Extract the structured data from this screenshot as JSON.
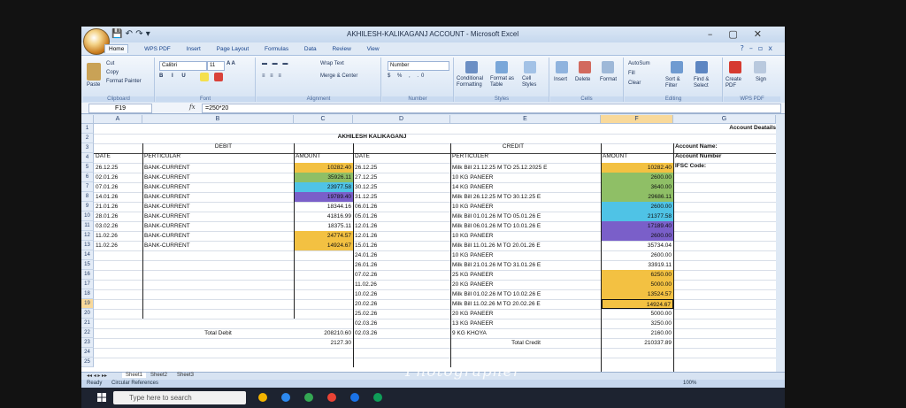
{
  "window": {
    "title": "AKHILESH-KALIKAGANJ ACCOUNT - Microsoft Excel",
    "minimize": "–",
    "maximize": "▢",
    "close": "✕"
  },
  "ribbon_tabs": [
    "Home",
    "WPS PDF",
    "Insert",
    "Page Layout",
    "Formulas",
    "Data",
    "Review",
    "View"
  ],
  "ribbon": {
    "clipboard": {
      "label": "Clipboard",
      "paste": "Paste",
      "cut": "Cut",
      "copy": "Copy",
      "format_painter": "Format Painter"
    },
    "font": {
      "label": "Font",
      "name": "Calibri",
      "size": "11"
    },
    "alignment": {
      "label": "Alignment",
      "wrap_text": "Wrap Text",
      "merge_center": "Merge & Center"
    },
    "number": {
      "label": "Number",
      "format": "Number"
    },
    "styles": {
      "label": "Styles",
      "conditional": "Conditional Formatting",
      "format_table": "Format as Table",
      "cell_styles": "Cell Styles"
    },
    "cells": {
      "label": "Cells",
      "insert": "Insert",
      "delete": "Delete",
      "format": "Format"
    },
    "editing": {
      "label": "Editing",
      "autosum": "AutoSum",
      "fill": "Fill",
      "clear": "Clear",
      "sort": "Sort & Filter",
      "find": "Find & Select"
    },
    "wps": {
      "label": "WPS PDF",
      "create": "Create PDF",
      "sign": "Sign"
    }
  },
  "formula_bar": {
    "name_box": "F19",
    "fx": "fx",
    "formula": "=250*20"
  },
  "columns": [
    "A",
    "B",
    "C",
    "D",
    "E",
    "F",
    "G"
  ],
  "rows": [
    "1",
    "2",
    "3",
    "4",
    "5",
    "6",
    "7",
    "8",
    "9",
    "10",
    "11",
    "12",
    "13",
    "14",
    "15",
    "16",
    "17",
    "18",
    "19",
    "20",
    "21",
    "22",
    "23",
    "24",
    "25"
  ],
  "sheet": {
    "title": "AKHILESH KALIKAGANJ",
    "debit_label": "DEBIT",
    "credit_label": "CREDIT",
    "headers": {
      "date": "DATE",
      "perticular": "PERTICULAR",
      "amount": "AMOUNT",
      "date2": "DATE",
      "perticuler": "PERTICULER",
      "amount2": "AMOUNT"
    },
    "debit_rows": [
      {
        "date": "26.12.25",
        "perticular": "BANK-CURRENT",
        "amount": "10282.40"
      },
      {
        "date": "02.01.26",
        "perticular": "BANK-CURRENT",
        "amount": "35926.11"
      },
      {
        "date": "07.01.26",
        "perticular": "BANK-CURRENT",
        "amount": "23977.58"
      },
      {
        "date": "14.01.26",
        "perticular": "BANK-CURRENT",
        "amount": "19789.40"
      },
      {
        "date": "21.01.26",
        "perticular": "BANK-CURRENT",
        "amount": "18344.16"
      },
      {
        "date": "28.01.26",
        "perticular": "BANK-CURRENT",
        "amount": "41816.99"
      },
      {
        "date": "03.02.26",
        "perticular": "BANK-CURRENT",
        "amount": "18375.11"
      },
      {
        "date": "11.02.26",
        "perticular": "BANK-CURRENT",
        "amount": "24774.57"
      },
      {
        "date": "11.02.26",
        "perticular": "BANK-CURRENT",
        "amount": "14924.67"
      }
    ],
    "credit_rows": [
      {
        "date": "26.12.25",
        "perticuler": "Milk Bill 21.12.25 M TO 25.12.2025 E",
        "amount": "10282.40"
      },
      {
        "date": "27.12.25",
        "perticuler": "10 KG PANEER",
        "amount": "2600.00"
      },
      {
        "date": "30.12.25",
        "perticuler": "14 KG PANEER",
        "amount": "3640.00"
      },
      {
        "date": "31.12.25",
        "perticuler": "Milk Bill 26.12.25 M TO 30.12.25 E",
        "amount": "29686.11"
      },
      {
        "date": "06.01.26",
        "perticuler": "10 KG PANEER",
        "amount": "2600.00"
      },
      {
        "date": "05.01.26",
        "perticuler": "Milk Bill 01.01.26 M TO 05.01.26 E",
        "amount": "21377.58"
      },
      {
        "date": "12.01.26",
        "perticuler": "Milk Bill 06.01.26 M TO 10.01.26 E",
        "amount": "17189.40"
      },
      {
        "date": "12.01.26",
        "perticuler": "10 KG PANEER",
        "amount": "2600.00"
      },
      {
        "date": "15.01.26",
        "perticuler": "Milk Bill 11.01.26 M TO 20.01.26 E",
        "amount": "35734.04"
      },
      {
        "date": "24.01.26",
        "perticuler": "10 KG PANEER",
        "amount": "2600.00"
      },
      {
        "date": "26.01.26",
        "perticuler": "Milk Bill 21.01.26 M TO 31.01.26 E",
        "amount": "33919.11"
      },
      {
        "date": "07.02.26",
        "perticuler": "25 KG PANEER",
        "amount": "6250.00"
      },
      {
        "date": "11.02.26",
        "perticuler": "20 KG PANEER",
        "amount": "5000.00"
      },
      {
        "date": "10.02.26",
        "perticuler": "Milk Bill 01.02.26 M TO 10.02.26 E",
        "amount": "13524.57"
      },
      {
        "date": "20.02.26",
        "perticuler": "Milk Bill 11.02.26 M TO 20.02.26 E",
        "amount": "14924.67"
      },
      {
        "date": "25.02.26",
        "perticuler": "20 KG PANEER",
        "amount": "5000.00"
      },
      {
        "date": "02.03.26",
        "perticuler": "13 KG PANEER",
        "amount": "3250.00"
      },
      {
        "date": "02.03.26",
        "perticuler": "9 KG KHOYA",
        "amount": "2160.00"
      }
    ],
    "total_debit_label": "Total Debit",
    "total_debit": "208210.60",
    "balance": "2127.30",
    "total_credit_label": "Total Credit",
    "total_credit": "210337.89",
    "account_details": {
      "title": "Account Deatails",
      "name": "Account Name:",
      "number": "Account Number",
      "ifsc": "IFSC Code:"
    }
  },
  "sheet_tabs": [
    "Sheet1",
    "Sheet2",
    "Sheet3"
  ],
  "status": {
    "ready": "Ready",
    "circular": "Circular References",
    "zoom": "100%"
  },
  "taskbar": {
    "search_placeholder": "Type here to search"
  },
  "watermark": "Photographer",
  "colors": {
    "yellow": "#f3c142",
    "blue": "#4fc3e6",
    "purple": "#7a5fc9",
    "green": "#8fbf66",
    "selected": "#f9d99a"
  }
}
